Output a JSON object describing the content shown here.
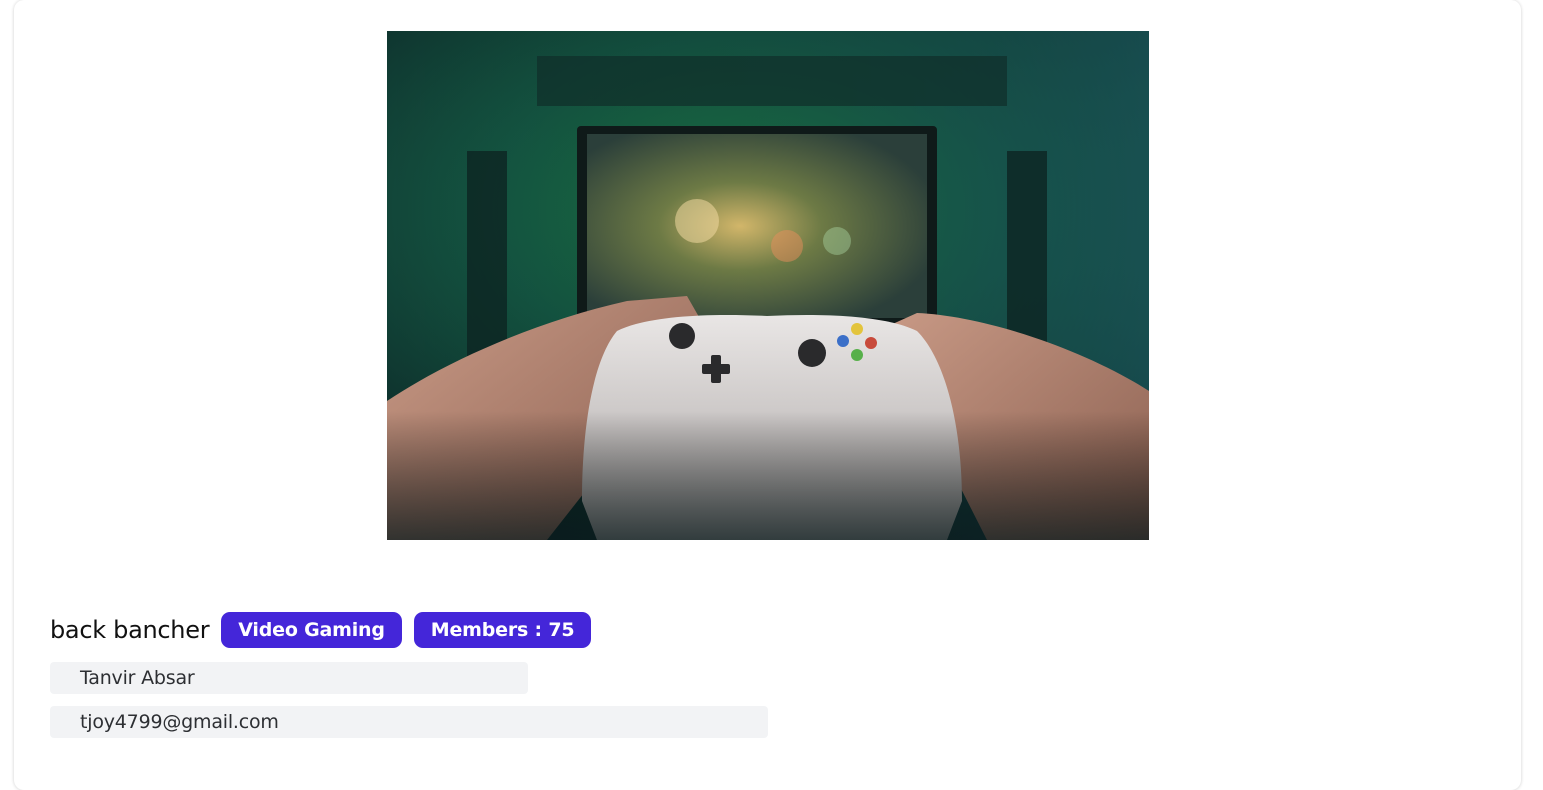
{
  "group": {
    "name": "back bancher",
    "category_badge": "Video Gaming",
    "members_badge": "Members : 75"
  },
  "owner": {
    "name": "Tanvir Absar",
    "email": "tjoy4799@gmail.com"
  },
  "colors": {
    "badge_background": "#4426d9",
    "field_background": "#f2f3f5"
  },
  "image": {
    "icon": "game-controller-photo"
  }
}
